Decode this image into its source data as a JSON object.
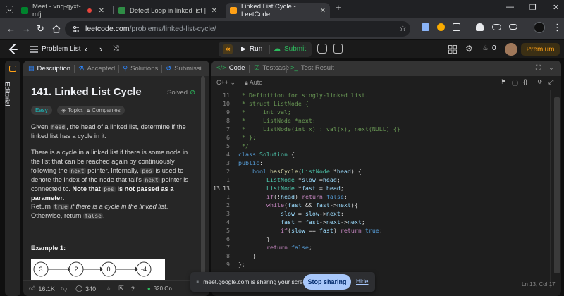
{
  "browser": {
    "tabs": [
      {
        "label": "Meet - vnq-qyxt-mfj",
        "active": false
      },
      {
        "label": "Detect Loop in linked list | Pract",
        "active": false
      },
      {
        "label": "Linked List Cycle - LeetCode",
        "active": true
      }
    ],
    "url_host": "leetcode.com",
    "url_path": "/problems/linked-list-cycle/"
  },
  "header": {
    "problem_list": "Problem List",
    "run": "Run",
    "submit": "Submit",
    "coins": "0",
    "premium": "Premium"
  },
  "sidebar": {
    "editorial": "Editorial"
  },
  "left_tabs": [
    "Description",
    "Accepted",
    "Solutions",
    "Submissi"
  ],
  "problem": {
    "title": "141. Linked List Cycle",
    "status": "Solved",
    "difficulty": "Easy",
    "topics": "Topics",
    "companies": "Companies",
    "p1_a": "Given ",
    "p1_code": "head",
    "p1_b": ", the head of a linked list, determine if the linked list has a cycle in it.",
    "p2_a": "There is a cycle in a linked list if there is some node in the list that can be reached again by continuously following the ",
    "p2_code1": "next",
    "p2_b": " pointer. Internally, ",
    "p2_code2": "pos",
    "p2_c": " is used to denote the index of the node that tail's ",
    "p2_code3": "next",
    "p2_d": " pointer is connected to. ",
    "p2_bold1": "Note that ",
    "p2_code4": "pos",
    "p2_bold2": " is not passed as a parameter",
    "p2_e": ".",
    "p3_a": "Return ",
    "p3_code1": "true",
    "p3_i": " if there is a cycle in the linked list",
    "p3_b": ". Otherwise, return ",
    "p3_code2": "false",
    "p3_c": ".",
    "example": "Example 1:",
    "nodes": [
      "3",
      "2",
      "0",
      "-4"
    ]
  },
  "footer": {
    "likes": "16.1K",
    "comments": "340",
    "online": "320 On"
  },
  "right_tabs": {
    "code": "Code",
    "testcase": "Testcase",
    "result": "Test Result"
  },
  "editor": {
    "language": "C++",
    "mode": "Auto",
    "marker": "13",
    "line_numbers": [
      "11",
      "10",
      "9",
      "8",
      "7",
      "6",
      "5",
      "4",
      "3",
      "2",
      "1",
      "13",
      "1",
      "2",
      "3",
      "4",
      "5",
      "6",
      "7",
      "8",
      "9"
    ],
    "cursor": "Ln 13, Col 17"
  },
  "share": {
    "text": "meet.google.com is sharing your screen.",
    "stop": "Stop sharing",
    "hide": "Hide"
  },
  "colors": {
    "accent": "#ffa116",
    "submit_green": "#2cbb5d",
    "solved_green": "#2cbb5d"
  }
}
